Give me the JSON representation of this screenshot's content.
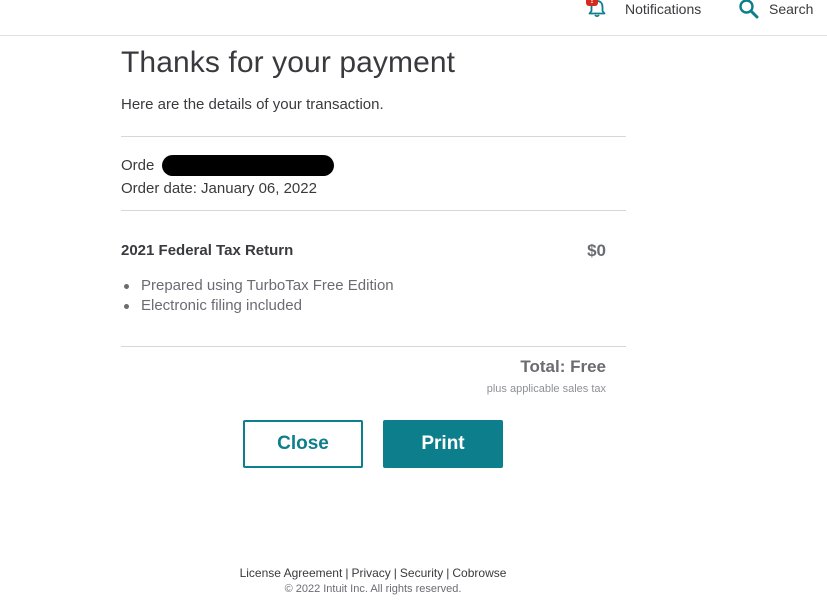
{
  "header": {
    "notifications_label": "Notifications",
    "notifications_badge": "!",
    "search_label": "Search"
  },
  "main": {
    "title": "Thanks for your payment",
    "subtitle": "Here are the details of your transaction.",
    "order_label": "Orde",
    "order_date": "Order date: January 06, 2022"
  },
  "product": {
    "name": "2021 Federal Tax Return",
    "price": "$0",
    "features": [
      "Prepared using TurboTax Free Edition",
      "Electronic filing included"
    ]
  },
  "summary": {
    "total": "Total: Free",
    "tax_note": "plus applicable sales tax"
  },
  "actions": {
    "close_label": "Close",
    "print_label": "Print"
  },
  "footer": {
    "links": [
      "License Agreement",
      "Privacy",
      "Security",
      "Cobrowse"
    ],
    "separator": "|",
    "copyright": "© 2022 Intuit Inc. All rights reserved."
  },
  "colors": {
    "accent": "#0d7f8c",
    "badge": "#d52b1e",
    "text": "#393a3d",
    "muted": "#6b6c72"
  }
}
